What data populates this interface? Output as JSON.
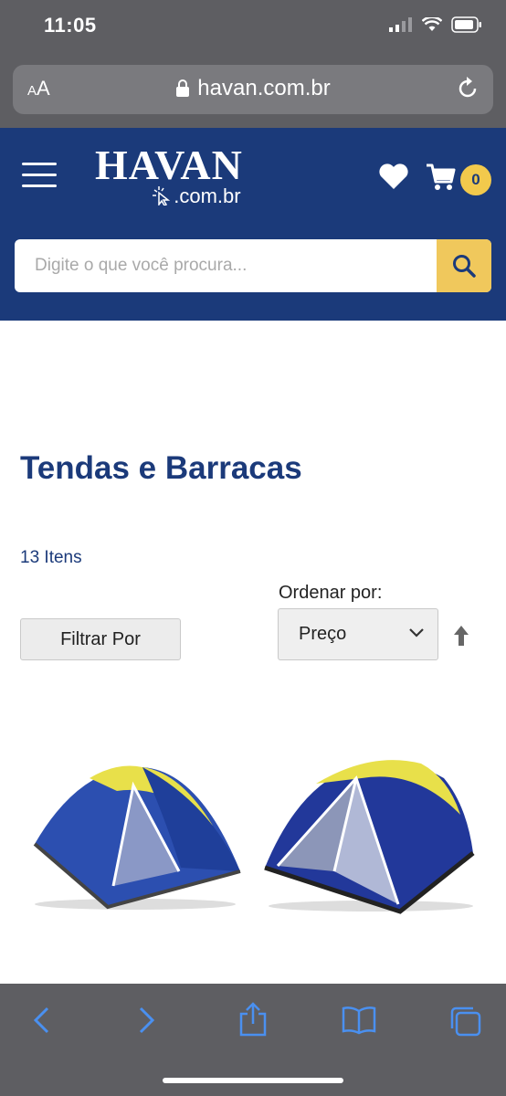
{
  "status": {
    "time": "11:05"
  },
  "browser": {
    "text_size_label_small": "A",
    "text_size_label": "A",
    "url": "havan.com.br"
  },
  "header": {
    "logo_main": "HAVAN",
    "logo_sub": ".com.br",
    "cart_count": "0",
    "search_placeholder": "Digite o que você procura..."
  },
  "content": {
    "title": "Tendas e Barracas",
    "item_count": "13 Itens",
    "filter_label": "Filtrar Por",
    "sort_label": "Ordenar por:",
    "sort_value": "Preço"
  },
  "colors": {
    "brand_blue": "#1b3a7a",
    "accent_yellow": "#f2c94c",
    "chrome_gray": "#5e5e62"
  }
}
